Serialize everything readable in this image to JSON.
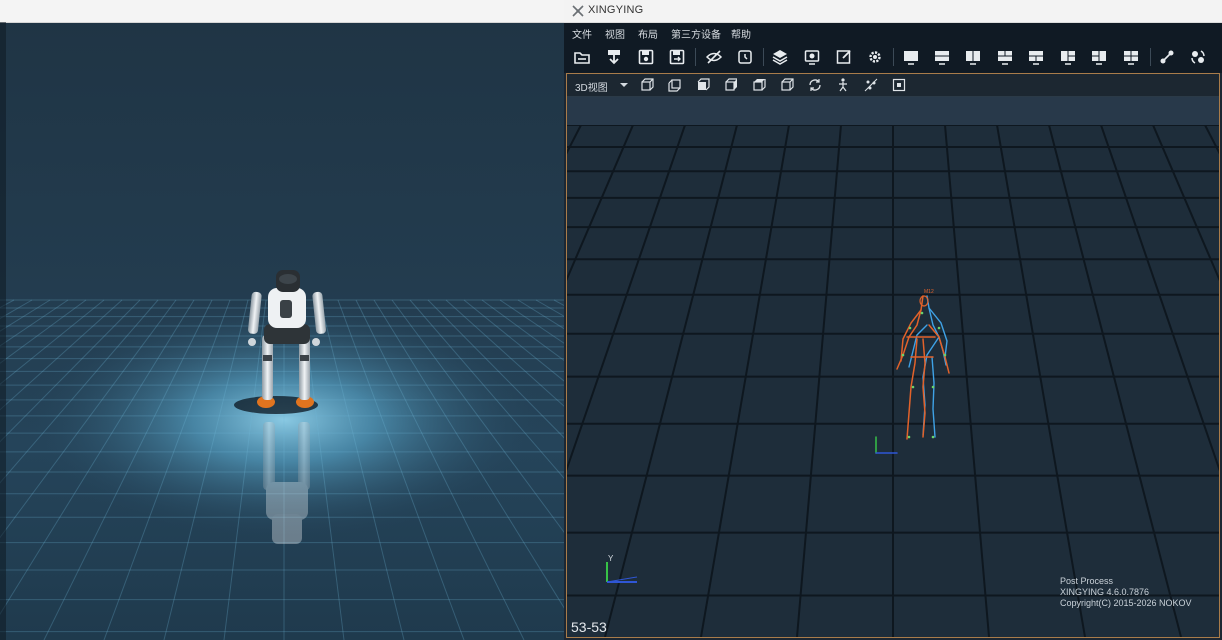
{
  "window": {
    "title": "XINGYING"
  },
  "menu": {
    "items": [
      "文件",
      "视图",
      "布局",
      "第三方设备",
      "帮助"
    ]
  },
  "toolbar": {
    "groups": [
      [
        "open-folder-icon",
        "export-icon",
        "save-settings-icon",
        "save-as-icon"
      ],
      [
        "hide-markers-icon",
        "timecode-icon"
      ],
      [
        "layers-icon",
        "camera-preview-icon",
        "edit-icon",
        "settings-gear-icon"
      ],
      [
        "layout-single-icon",
        "layout-top-bottom-icon",
        "layout-left-right-icon",
        "layout-three-top-icon",
        "layout-three-bottom-icon",
        "layout-three-left-icon",
        "layout-three-right-icon",
        "layout-quad-icon"
      ],
      [
        "skeleton-link-icon",
        "plugin-icon"
      ]
    ]
  },
  "viewport": {
    "view_mode": "3D视图",
    "view_buttons": [
      "view-front-icon",
      "view-back-icon",
      "view-left-icon",
      "view-right-icon",
      "view-top-icon",
      "view-bottom-icon",
      "rotate-view-icon",
      "skeleton-toggle-icon",
      "marker-toggle-icon",
      "fit-view-icon"
    ],
    "frame_counter": "53-53",
    "info": {
      "mode": "Post Process",
      "version": "XINGYING 4.6.0.7876",
      "copyright": "Copyright(C) 2015-2026 NOKOV"
    },
    "axis_label": "Y",
    "skeleton_label": "M12"
  },
  "colors": {
    "accent_border": "#a97c4a",
    "skeleton_orange": "#e2622a",
    "skeleton_blue": "#3fa2e6"
  }
}
